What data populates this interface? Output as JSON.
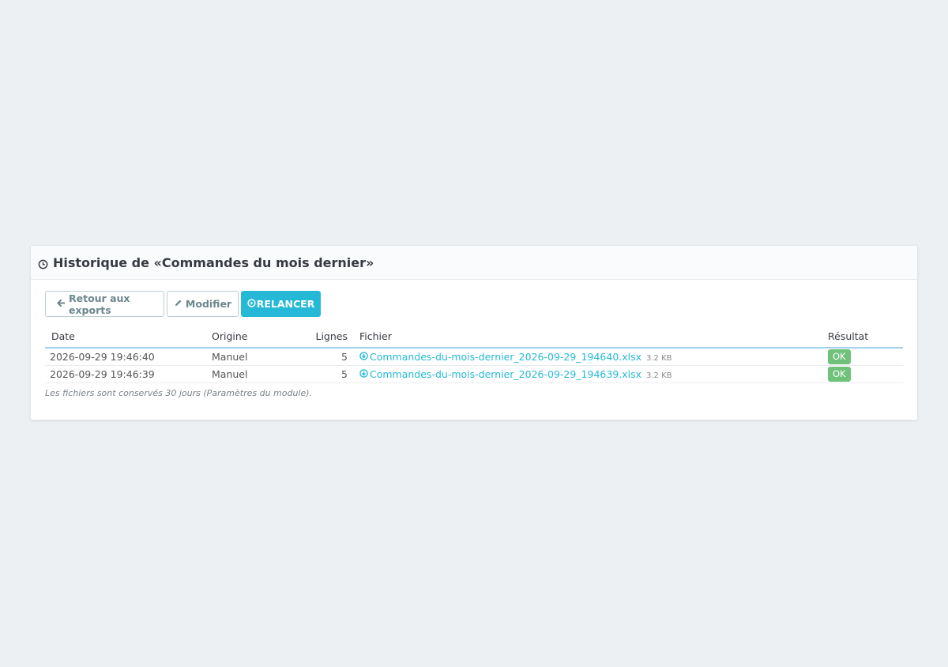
{
  "panel": {
    "title": "Historique de «Commandes du mois dernier»",
    "title_icon": "clock-icon"
  },
  "toolbar": {
    "back_label": "Retour aux exports",
    "edit_label": "Modifier",
    "rerun_label": "RELANCER"
  },
  "table": {
    "headers": {
      "date": "Date",
      "origin": "Origine",
      "lines": "Lignes",
      "file": "Fichier",
      "result": "Résultat"
    },
    "rows": [
      {
        "date": "2026-09-29 19:46:40",
        "origin": "Manuel",
        "lines": "5",
        "file": "Commandes-du-mois-dernier_2026-09-29_194640.xlsx",
        "size": "3.2 KB",
        "result": "OK"
      },
      {
        "date": "2026-09-29 19:46:39",
        "origin": "Manuel",
        "lines": "5",
        "file": "Commandes-du-mois-dernier_2026-09-29_194639.xlsx",
        "size": "3.2 KB",
        "result": "OK"
      }
    ]
  },
  "note": "Les fichiers sont conservés 30 jours (Paramètres du module).",
  "colors": {
    "accent": "#25b9d7",
    "success": "#70c17a",
    "background": "#edf0f3"
  }
}
